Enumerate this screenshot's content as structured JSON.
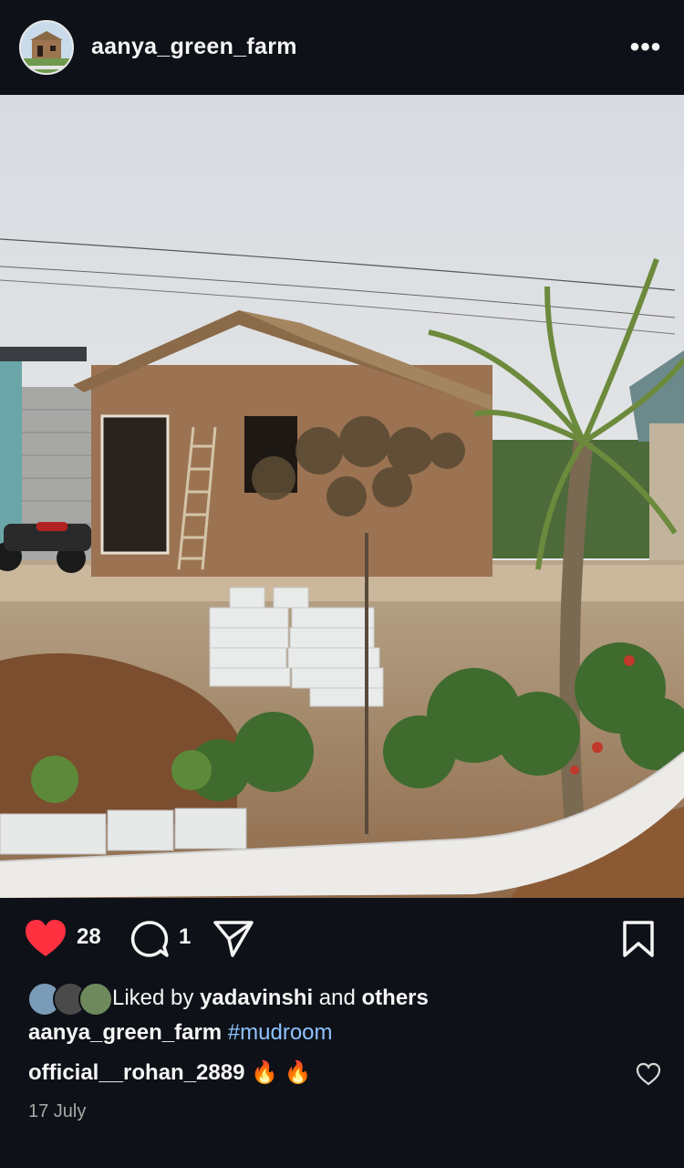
{
  "header": {
    "username": "aanya_green_farm",
    "more_icon": "more-horizontal-icon",
    "more_glyph": "•••"
  },
  "post": {
    "image_alt": "mud house with thatched roof, palm tree and garden"
  },
  "actions": {
    "like_count": "28",
    "comment_count": "1",
    "like_icon": "heart-filled-icon",
    "comment_icon": "comment-icon",
    "share_icon": "send-icon",
    "save_icon": "bookmark-icon",
    "colors": {
      "like": "#ff3040"
    }
  },
  "likes": {
    "prefix": "Liked by ",
    "user": "yadavinshi",
    "middle": " and ",
    "others": "others"
  },
  "caption": {
    "username": "aanya_green_farm",
    "hashtag": "#mudroom"
  },
  "comment": {
    "username": "official__rohan_2889",
    "emojis": "🔥 🔥"
  },
  "date": "17 July"
}
